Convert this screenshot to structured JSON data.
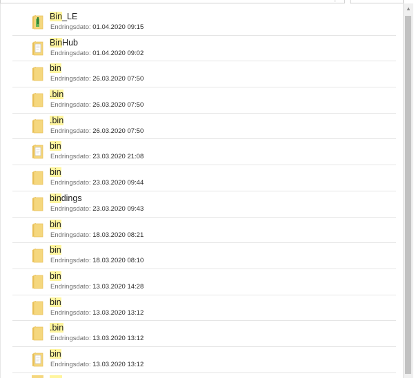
{
  "files": [
    {
      "highlight": "Bin",
      "rest": "_LE",
      "date_label": "Endringsdato:",
      "date": "01.04.2020 09:15",
      "icon": "app-folder-icon"
    },
    {
      "highlight": "Bin",
      "rest": "Hub",
      "date_label": "Endringsdato:",
      "date": "01.04.2020 09:02",
      "icon": "document-folder-icon"
    },
    {
      "highlight": "bin",
      "rest": "",
      "date_label": "Endringsdato:",
      "date": "26.03.2020 07:50",
      "icon": "folder-icon"
    },
    {
      "highlight": ".bin",
      "rest": "",
      "date_label": "Endringsdato:",
      "date": "26.03.2020 07:50",
      "icon": "folder-icon"
    },
    {
      "highlight": ".bin",
      "rest": "",
      "date_label": "Endringsdato:",
      "date": "26.03.2020 07:50",
      "icon": "folder-icon"
    },
    {
      "highlight": "bin",
      "rest": "",
      "date_label": "Endringsdato:",
      "date": "23.03.2020 21:08",
      "icon": "document-folder-icon"
    },
    {
      "highlight": "bin",
      "rest": "",
      "date_label": "Endringsdato:",
      "date": "23.03.2020 09:44",
      "icon": "folder-icon"
    },
    {
      "highlight": "bin",
      "rest": "dings",
      "date_label": "Endringsdato:",
      "date": "23.03.2020 09:43",
      "icon": "folder-icon"
    },
    {
      "highlight": "bin",
      "rest": "",
      "date_label": "Endringsdato:",
      "date": "18.03.2020 08:21",
      "icon": "folder-icon"
    },
    {
      "highlight": "bin",
      "rest": "",
      "date_label": "Endringsdato:",
      "date": "18.03.2020 08:10",
      "icon": "folder-icon"
    },
    {
      "highlight": "bin",
      "rest": "",
      "date_label": "Endringsdato:",
      "date": "13.03.2020 14:28",
      "icon": "folder-icon"
    },
    {
      "highlight": "bin",
      "rest": "",
      "date_label": "Endringsdato:",
      "date": "13.03.2020 13:12",
      "icon": "folder-icon"
    },
    {
      "highlight": ".bin",
      "rest": "",
      "date_label": "Endringsdato:",
      "date": "13.03.2020 13:12",
      "icon": "folder-icon"
    },
    {
      "highlight": "bin",
      "rest": "",
      "date_label": "Endringsdato:",
      "date": "13.03.2020 13:12",
      "icon": "document-folder-icon"
    }
  ],
  "colors": {
    "highlight": "#fff59e",
    "folder": "#f5d77e",
    "folder_dark": "#e8bf55",
    "meta_text": "#6d6d6d",
    "separator": "#e5e5e5"
  }
}
